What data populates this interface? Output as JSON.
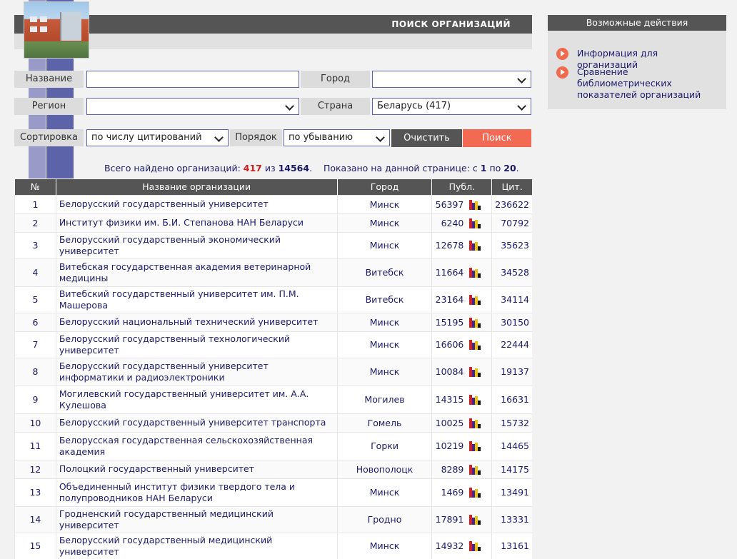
{
  "header": {
    "title": "ПОИСК ОРГАНИЗАЦИЙ"
  },
  "filters": {
    "name_label": "Название",
    "name_value": "",
    "city_label": "Город",
    "city_value": "",
    "region_label": "Регион",
    "region_value": "",
    "country_label": "Страна",
    "country_value": "Беларусь  (417)",
    "sort_label": "Сортировка",
    "sort_value": "по числу цитирований",
    "order_label": "Порядок",
    "order_value": "по убыванию",
    "clear_label": "Очистить",
    "search_label": "Поиск"
  },
  "summary": {
    "prefix": "Всего найдено организаций: ",
    "found": "417",
    "of": " из ",
    "total": "14564",
    "mid": ".    Показано на данной странице: с ",
    "from": "1",
    "to_word": " по ",
    "to": "20",
    "end": "."
  },
  "table": {
    "headers": [
      "№",
      "Название организации",
      "Город",
      "Публ.",
      "Цит."
    ],
    "rows": [
      {
        "n": "1",
        "name": "Белорусский государственный университет",
        "city": "Минск",
        "pub": "56397",
        "cit": "236622"
      },
      {
        "n": "2",
        "name": "Институт физики им. Б.И. Степанова НАН Беларуси",
        "city": "Минск",
        "pub": "6240",
        "cit": "70792"
      },
      {
        "n": "3",
        "name": "Белорусский государственный экономический университет",
        "city": "Минск",
        "pub": "12678",
        "cit": "35623"
      },
      {
        "n": "4",
        "name": "Витебская государственная академия ветеринарной медицины",
        "city": "Витебск",
        "pub": "11664",
        "cit": "34528"
      },
      {
        "n": "5",
        "name": "Витебский государственный университет им. П.М. Машерова",
        "city": "Витебск",
        "pub": "23164",
        "cit": "34114"
      },
      {
        "n": "6",
        "name": "Белорусский национальный технический университет",
        "city": "Минск",
        "pub": "15195",
        "cit": "30150"
      },
      {
        "n": "7",
        "name": "Белорусский государственный технологический университет",
        "city": "Минск",
        "pub": "16606",
        "cit": "22444"
      },
      {
        "n": "8",
        "name": "Белорусский государственный университет информатики и радиоэлектроники",
        "city": "Минск",
        "pub": "10084",
        "cit": "19137"
      },
      {
        "n": "9",
        "name": "Могилевский государственный университет им. А.А. Кулешова",
        "city": "Могилев",
        "pub": "14315",
        "cit": "16631"
      },
      {
        "n": "10",
        "name": "Белорусский государственный университет транспорта",
        "city": "Гомель",
        "pub": "10025",
        "cit": "15732"
      },
      {
        "n": "11",
        "name": "Белорусская государственная сельскохозяйственная академия",
        "city": "Горки",
        "pub": "10219",
        "cit": "14465"
      },
      {
        "n": "12",
        "name": "Полоцкий государственный университет",
        "city": "Новополоцк",
        "pub": "8289",
        "cit": "14175"
      },
      {
        "n": "13",
        "name": "Объединенный институт физики твердого тела и полупроводников НАН Беларуси",
        "city": "Минск",
        "pub": "1469",
        "cit": "13491"
      },
      {
        "n": "14",
        "name": "Гродненский государственный медицинский университет",
        "city": "Гродно",
        "pub": "17891",
        "cit": "13331"
      },
      {
        "n": "15",
        "name": "Белорусский государственный медицинский университет",
        "city": "Минск",
        "pub": "14932",
        "cit": "13161"
      }
    ]
  },
  "sidebar": {
    "title": "Возможные действия",
    "items": [
      {
        "label": "Информация для организаций"
      },
      {
        "label": "Сравнение библиометрических показателей организаций"
      }
    ]
  },
  "colors": {
    "header_bg": "#555555",
    "accent": "#f26a53",
    "link": "#1a1a6a",
    "highlight": "#d01e1e"
  }
}
